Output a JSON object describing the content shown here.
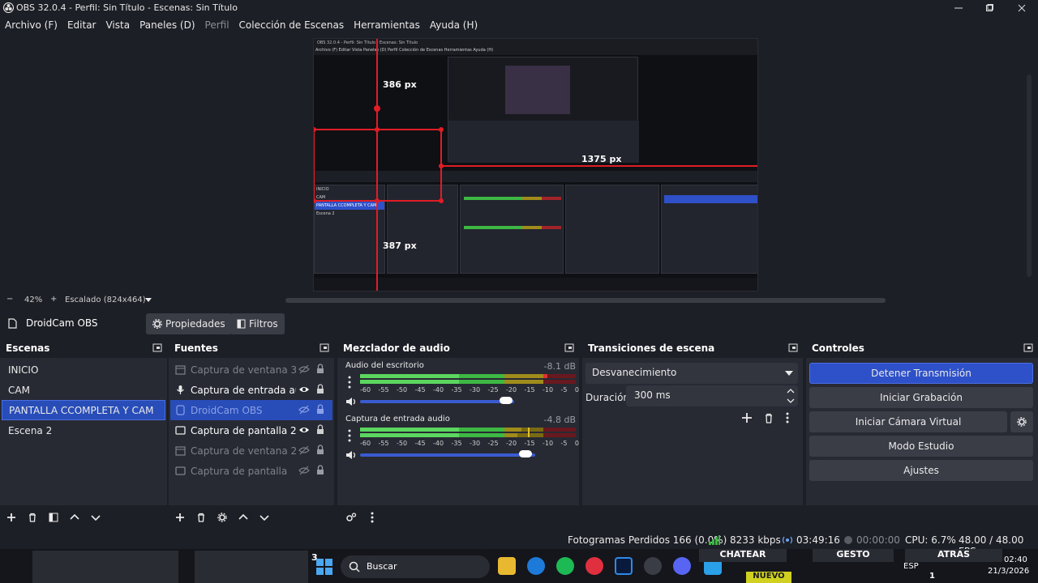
{
  "window": {
    "title": "OBS 32.0.4 - Perfil: Sin Título - Escenas: Sin Título"
  },
  "menu": [
    {
      "label": "Archivo (F)",
      "enabled": true
    },
    {
      "label": "Editar",
      "enabled": true
    },
    {
      "label": "Vista",
      "enabled": true
    },
    {
      "label": "Paneles (D)",
      "enabled": true
    },
    {
      "label": "Perfil",
      "enabled": false
    },
    {
      "label": "Colección de Escenas",
      "enabled": true
    },
    {
      "label": "Herramientas",
      "enabled": true
    },
    {
      "label": "Ayuda (H)",
      "enabled": true
    }
  ],
  "preview": {
    "labels": {
      "top": "386 px",
      "right": "1375 px",
      "bottom": "387 px"
    },
    "nested_title": "OBS 32.0.4 - Perfil: Sin Título - Escenas: Sin Título",
    "nested_menu": "Archivo (F)   Editar   Vista   Paneles (D)   Perfil   Colección de Escenas   Herramientas   Ayuda (H)"
  },
  "zoombar": {
    "minus": "−",
    "zoom": "42%",
    "plus": "+",
    "scale": "Escalado (824x464)"
  },
  "source_toolbar": {
    "source_name": "DroidCam OBS",
    "properties": "Propiedades",
    "filters": "Filtros"
  },
  "scenes": {
    "title": "Escenas",
    "items": [
      {
        "name": "INICIO",
        "selected": false
      },
      {
        "name": "CAM",
        "selected": false
      },
      {
        "name": "PANTALLA CCOMPLETA Y CAM",
        "selected": true
      },
      {
        "name": "Escena 2",
        "selected": false
      }
    ]
  },
  "sources": {
    "title": "Fuentes",
    "items": [
      {
        "name": "Captura de ventana 3",
        "icon": "window-icon",
        "visible": false,
        "selected": false
      },
      {
        "name": "Captura de entrada audio",
        "icon": "microphone-icon",
        "visible": true,
        "selected": false
      },
      {
        "name": "DroidCam OBS",
        "icon": "camera-icon",
        "visible": false,
        "selected": true
      },
      {
        "name": "Captura de pantalla 2",
        "icon": "monitor-icon",
        "visible": true,
        "selected": false
      },
      {
        "name": "Captura de ventana 2",
        "icon": "window-icon",
        "visible": false,
        "selected": false
      },
      {
        "name": "Captura de pantalla",
        "icon": "monitor-icon",
        "visible": false,
        "selected": false
      }
    ]
  },
  "mixer": {
    "title": "Mezclador de audio",
    "scale": [
      "-60",
      "-55",
      "-50",
      "-45",
      "-40",
      "-35",
      "-30",
      "-25",
      "-20",
      "-15",
      "-10",
      "-5",
      "0"
    ],
    "channels": [
      {
        "name": "Audio del escritorio",
        "db": "-8.1 dB",
        "volume": 0.85
      },
      {
        "name": "Captura de entrada audio",
        "db": "-4.8 dB",
        "volume": 0.9
      }
    ]
  },
  "transitions": {
    "title": "Transiciones de escena",
    "selected": "Desvanecimiento",
    "duration_label": "Duración",
    "duration": "300 ms"
  },
  "controls": {
    "title": "Controles",
    "buttons": [
      "Detener Transmisión",
      "Iniciar Grabación",
      "Iniciar Cámara Virtual",
      "Modo Estudio",
      "Ajustes"
    ]
  },
  "status": {
    "dropped": "Fotogramas Perdidos 166 (0.0%)",
    "bitrate": "8233 kbps",
    "stream_time": "03:49:16",
    "rec_time": "00:00:00",
    "cpu": "CPU: 6.7%",
    "fps": "48.00 / 48.00 FPS"
  },
  "taskbar": {
    "search": "Buscar",
    "lang": "ESP",
    "time": "02:40",
    "date": "21/3/2026",
    "tiles": [
      "CHATEAR",
      "GESTO",
      "ATRAS",
      "NUEVO"
    ],
    "badge": "3",
    "badge2": "1"
  },
  "colors": {
    "accent": "#2e50c8",
    "bg": "#1d1f26",
    "panel": "#272a33",
    "guide": "#e01c24"
  }
}
